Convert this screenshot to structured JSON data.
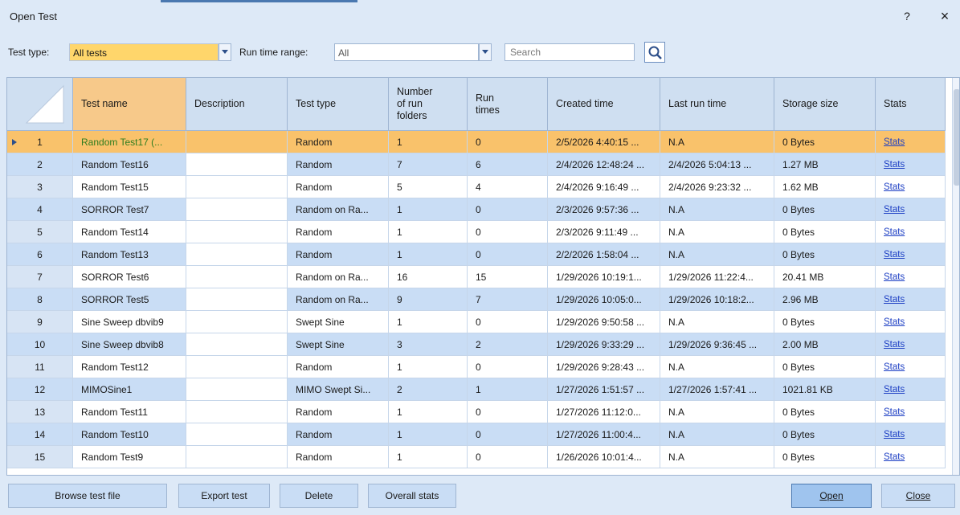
{
  "window": {
    "title": "Open Test",
    "help": "?",
    "close": "×"
  },
  "filters": {
    "test_type_label": "Test type:",
    "test_type_value": "All tests",
    "run_time_label": "Run time range:",
    "run_time_value": "All",
    "search_placeholder": "Search"
  },
  "columns": [
    "Test name",
    "Description",
    "Test type",
    "Number of run folders",
    "Run times",
    "Created time",
    "Last run time",
    "Storage size",
    "Stats"
  ],
  "column_display": {
    "test_name": "Test name",
    "description": "Description",
    "test_type": "Test type",
    "folders_l1": "Number",
    "folders_l2": "of run",
    "folders_l3": "folders",
    "runtimes_l1": "Run",
    "runtimes_l2": "times",
    "created": "Created time",
    "lastrun": "Last run time",
    "storage": "Storage size",
    "stats": "Stats"
  },
  "rows": [
    {
      "n": "1",
      "name": "Random Test17 (...",
      "desc": "",
      "type": "Random",
      "folders": "1",
      "runs": "0",
      "created": "2/5/2026 4:40:15 ...",
      "last": "N.A",
      "size": "0 Bytes",
      "stats": "Stats"
    },
    {
      "n": "2",
      "name": "Random Test16",
      "desc": "",
      "type": "Random",
      "folders": "7",
      "runs": "6",
      "created": "2/4/2026 12:48:24 ...",
      "last": "2/4/2026 5:04:13 ...",
      "size": "1.27 MB",
      "stats": "Stats"
    },
    {
      "n": "3",
      "name": "Random Test15",
      "desc": "",
      "type": "Random",
      "folders": "5",
      "runs": "4",
      "created": "2/4/2026 9:16:49 ...",
      "last": "2/4/2026 9:23:32 ...",
      "size": "1.62 MB",
      "stats": "Stats"
    },
    {
      "n": "4",
      "name": "SORROR Test7",
      "desc": "",
      "type": "Random on Ra...",
      "folders": "1",
      "runs": "0",
      "created": "2/3/2026 9:57:36 ...",
      "last": "N.A",
      "size": "0 Bytes",
      "stats": "Stats"
    },
    {
      "n": "5",
      "name": "Random Test14",
      "desc": "",
      "type": "Random",
      "folders": "1",
      "runs": "0",
      "created": "2/3/2026 9:11:49 ...",
      "last": "N.A",
      "size": "0 Bytes",
      "stats": "Stats"
    },
    {
      "n": "6",
      "name": "Random Test13",
      "desc": "",
      "type": "Random",
      "folders": "1",
      "runs": "0",
      "created": "2/2/2026 1:58:04 ...",
      "last": "N.A",
      "size": "0 Bytes",
      "stats": "Stats"
    },
    {
      "n": "7",
      "name": "SORROR Test6",
      "desc": "",
      "type": "Random on Ra...",
      "folders": "16",
      "runs": "15",
      "created": "1/29/2026 10:19:1...",
      "last": "1/29/2026 11:22:4...",
      "size": "20.41 MB",
      "stats": "Stats"
    },
    {
      "n": "8",
      "name": "SORROR Test5",
      "desc": "",
      "type": "Random on Ra...",
      "folders": "9",
      "runs": "7",
      "created": "1/29/2026 10:05:0...",
      "last": "1/29/2026 10:18:2...",
      "size": "2.96 MB",
      "stats": "Stats"
    },
    {
      "n": "9",
      "name": "Sine Sweep dbvib9",
      "desc": "",
      "type": "Swept Sine",
      "folders": "1",
      "runs": "0",
      "created": "1/29/2026 9:50:58 ...",
      "last": "N.A",
      "size": "0 Bytes",
      "stats": "Stats"
    },
    {
      "n": "10",
      "name": "Sine Sweep dbvib8",
      "desc": "",
      "type": "Swept Sine",
      "folders": "3",
      "runs": "2",
      "created": "1/29/2026 9:33:29 ...",
      "last": "1/29/2026 9:36:45 ...",
      "size": "2.00 MB",
      "stats": "Stats"
    },
    {
      "n": "11",
      "name": "Random Test12",
      "desc": "",
      "type": "Random",
      "folders": "1",
      "runs": "0",
      "created": "1/29/2026 9:28:43 ...",
      "last": "N.A",
      "size": "0 Bytes",
      "stats": "Stats"
    },
    {
      "n": "12",
      "name": "MIMOSine1",
      "desc": "",
      "type": "MIMO Swept Si...",
      "folders": "2",
      "runs": "1",
      "created": "1/27/2026 1:51:57 ...",
      "last": "1/27/2026 1:57:41 ...",
      "size": "1021.81 KB",
      "stats": "Stats"
    },
    {
      "n": "13",
      "name": "Random Test11",
      "desc": "",
      "type": "Random",
      "folders": "1",
      "runs": "0",
      "created": "1/27/2026 11:12:0...",
      "last": "N.A",
      "size": "0 Bytes",
      "stats": "Stats"
    },
    {
      "n": "14",
      "name": "Random Test10",
      "desc": "",
      "type": "Random",
      "folders": "1",
      "runs": "0",
      "created": "1/27/2026 11:00:4...",
      "last": "N.A",
      "size": "0 Bytes",
      "stats": "Stats"
    },
    {
      "n": "15",
      "name": "Random Test9",
      "desc": "",
      "type": "Random",
      "folders": "1",
      "runs": "0",
      "created": "1/26/2026 10:01:4...",
      "last": "N.A",
      "size": "0 Bytes",
      "stats": "Stats"
    }
  ],
  "selected_row": "1",
  "buttons": {
    "browse": "Browse test file",
    "export": "Export test",
    "delete": "Delete",
    "overall": "Overall stats",
    "open": "Open",
    "close": "Close"
  },
  "colors": {
    "selected_row": "#f9c26b",
    "alt_row": "#c9ddf5",
    "sorted_header": "#f7c98a",
    "link": "#1d3fc4",
    "selected_name_text": "#2e7d1f"
  }
}
